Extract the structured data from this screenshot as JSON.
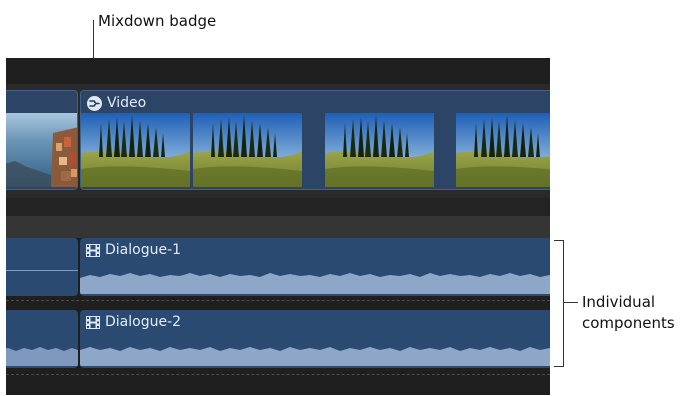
{
  "callouts": {
    "mixdown": "Mixdown badge",
    "components_line1": "Individual",
    "components_line2": "components"
  },
  "clips": {
    "video": {
      "label": "Video",
      "badge_icon": "mixdown-badge-icon"
    },
    "dialogue1": {
      "label": "Dialogue-1",
      "icon": "film-strip-icon"
    },
    "dialogue2": {
      "label": "Dialogue-2",
      "icon": "film-strip-icon"
    }
  },
  "colors": {
    "timeline_bg": "#262626",
    "clip_blue": "#2a4a72",
    "waveform": "#8ea7c8"
  }
}
